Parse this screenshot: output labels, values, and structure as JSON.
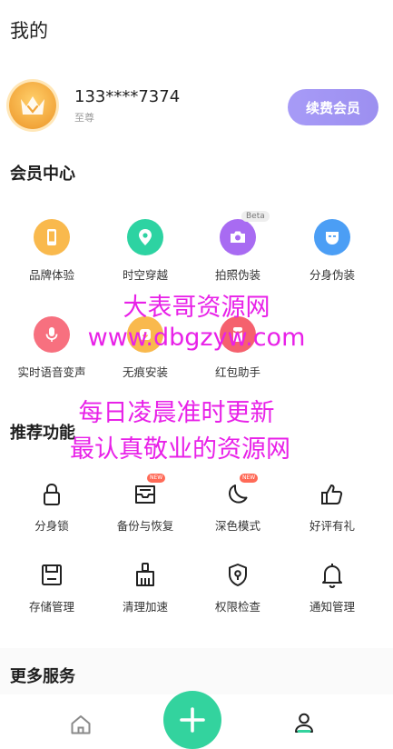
{
  "header": {
    "title": "我的"
  },
  "profile": {
    "phone": "133****7374",
    "level": "至尊",
    "renew_label": "续费会员"
  },
  "member_center": {
    "title": "会员中心",
    "items": [
      {
        "label": "品牌体验",
        "icon": "phone-icon",
        "color": "#f9b94d"
      },
      {
        "label": "时空穿越",
        "icon": "location-pin-icon",
        "color": "#2dd3a2"
      },
      {
        "label": "拍照伪装",
        "icon": "camera-icon",
        "color": "#a86bf2",
        "badge": "Beta"
      },
      {
        "label": "分身伪装",
        "icon": "mask-icon",
        "color": "#4b9ef5"
      },
      {
        "label": "实时语音变声",
        "icon": "microphone-icon",
        "color": "#f7707f"
      },
      {
        "label": "无痕安装",
        "icon": "install-icon",
        "color": "#f9b94d"
      },
      {
        "label": "红包助手",
        "icon": "red-envelope-icon",
        "color": "#f5616e"
      }
    ]
  },
  "recommended": {
    "title": "推荐功能",
    "items": [
      {
        "label": "分身锁",
        "icon": "lock-icon"
      },
      {
        "label": "备份与恢复",
        "icon": "inbox-icon",
        "badge": "NEW"
      },
      {
        "label": "深色模式",
        "icon": "moon-icon",
        "badge": "NEW"
      },
      {
        "label": "好评有礼",
        "icon": "thumbs-up-icon"
      },
      {
        "label": "存储管理",
        "icon": "floppy-disk-icon"
      },
      {
        "label": "清理加速",
        "icon": "broom-icon"
      },
      {
        "label": "权限检查",
        "icon": "shield-icon"
      },
      {
        "label": "通知管理",
        "icon": "bell-icon"
      }
    ]
  },
  "more_services": {
    "title": "更多服务"
  },
  "watermark": {
    "line1": "大表哥资源网",
    "line2": "www.dbgzyw.com",
    "line3": "每日凌晨准时更新",
    "line4": "最认真敬业的资源网",
    "color": "#e821e8"
  },
  "tab_bar": {
    "items": [
      "home-icon",
      "add-icon",
      "user-icon"
    ],
    "fab_color": "#33d39e"
  }
}
